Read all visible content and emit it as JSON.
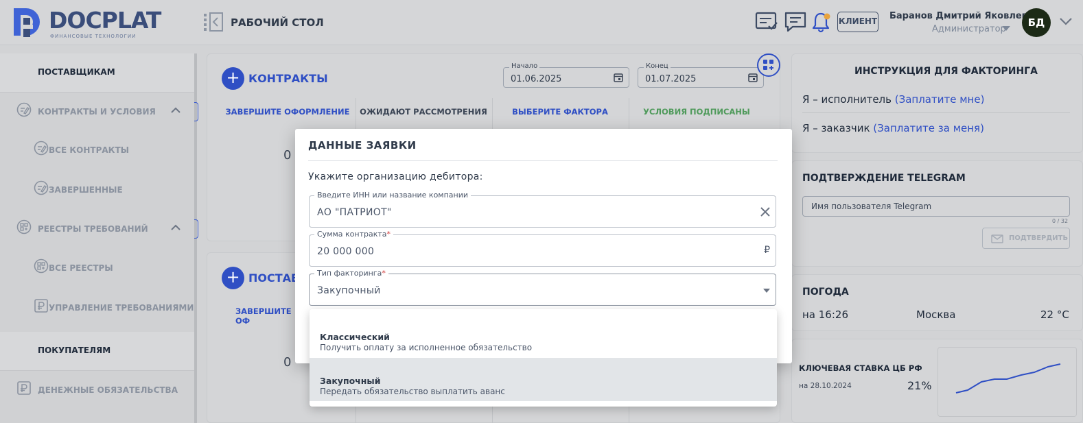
{
  "header": {
    "logo_text": "DOCPLAT",
    "logo_sub": "ФИНАНСОВЫЕ ТЕХНОЛОГИИ",
    "page_title": "РАБОЧИЙ СТОЛ",
    "client_badge": "КЛИЕНТ",
    "user_name": "Баранов Дмитрий Яковлевич",
    "user_role": "Администратор",
    "avatar_initials": "БД",
    "notification_dot_color": "#e8a33d"
  },
  "sidebar": {
    "section_suppliers": "ПОСТАВЩИКАМ",
    "contracts_group": "КОНТРАКТЫ И УСЛОВИЯ",
    "all_contracts": "ВСЕ КОНТРАКТЫ",
    "completed": "ЗАВЕРШЕННЫЕ",
    "registries_group": "РЕЕСТРЫ ТРЕБОВАНИЙ",
    "all_registries": "ВСЕ РЕЕСТРЫ",
    "manage_claims": "УПРАВЛЕНИЕ ТРЕБОВАНИЯМИ",
    "section_buyers": "ПОКУПАТЕЛЯМ",
    "money_obligations": "ДЕНЕЖНЫЕ ОБЯЗАТЕЛЬСТВА"
  },
  "contracts_card": {
    "title": "КОНТРАКТЫ",
    "start_label": "Начало",
    "start_value": "01.06.2025",
    "end_label": "Конец",
    "end_value": "01.07.2025",
    "tabs": [
      "ЗАВЕРШИТЕ ОФОРМЛЕНИЕ",
      "ОЖИДАЮТ РАССМОТРЕНИЯ",
      "ВЫБЕРИТЕ ФАКТОРА",
      "УСЛОВИЯ ПОДПИСАНЫ"
    ],
    "count": "0"
  },
  "supplies_card": {
    "title": "ПОСТАВК",
    "tab_first": "ЗАВЕРШИТЕ ОФ",
    "count": "0"
  },
  "right_panel": {
    "instructions_title": "ИНСТРУКЦИЯ ДЛЯ ФАКТОРИНГА",
    "executor_prefix": "Я – исполнитель ",
    "executor_link": "(Заплатите мне)",
    "customer_prefix": "Я – заказчик ",
    "customer_link": "(Заплатите за меня)",
    "telegram_title": "ПОДТВЕРЖДЕНИЕ TELEGRAM",
    "telegram_placeholder": "Имя пользователя Telegram",
    "telegram_counter": "0 / 32",
    "telegram_button": "ПОДТВЕРДИТЬ",
    "weather_title": "ПОГОДА",
    "weather_time": "на 16:26",
    "weather_city": "Москва",
    "weather_temp": "22 °C",
    "rate_title": "КЛЮЧЕВАЯ СТАВКА ЦБ РФ",
    "rate_date": "на 28.10.2024",
    "rate_value": "21%"
  },
  "dialog": {
    "title": "ДАННЫЕ ЗАЯВКИ",
    "prompt": "Укажите организацию дебитора:",
    "org_label": "Введите ИНН или название компании",
    "org_value": "АО \"ПАТРИОТ\"",
    "amount_label": "Сумма контракта",
    "amount_value": "20 000 000",
    "currency": "₽",
    "type_label": "Тип факторинга",
    "type_value": "Закупочный",
    "required_mark": "*"
  },
  "dropdown": {
    "options": [
      {
        "title": "Классический",
        "subtitle": "Получить оплату за исполненное обязательство"
      },
      {
        "title": "Закупочный",
        "subtitle": "Передать обязательство выплатить аванс"
      }
    ]
  },
  "colors": {
    "accent": "#2f4fc4",
    "signed_green": "#4f9a5b"
  }
}
